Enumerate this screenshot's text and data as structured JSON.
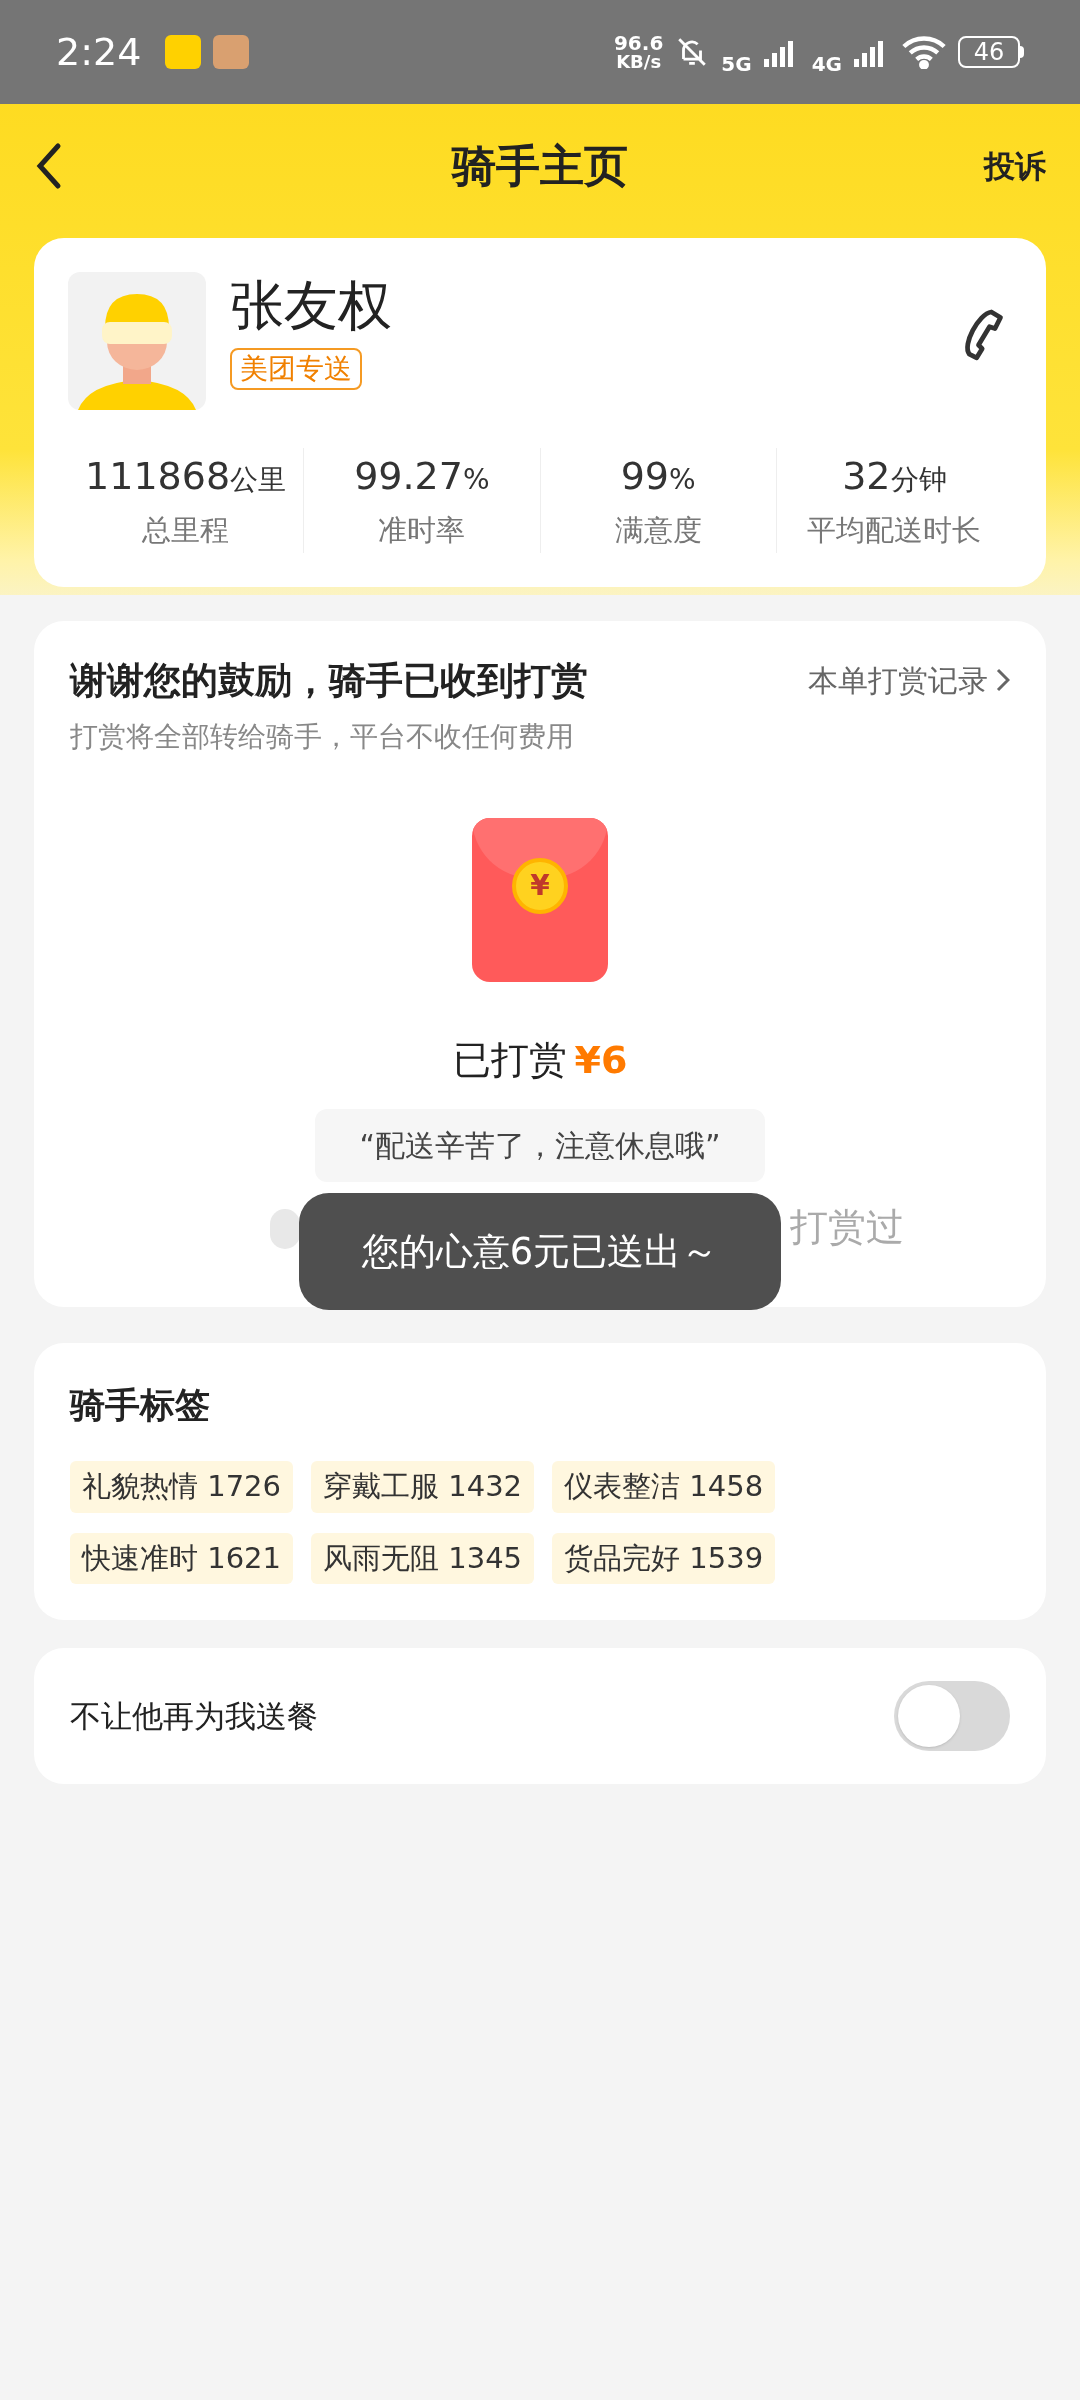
{
  "status_bar": {
    "time": "2:24",
    "speed_value": "96.6",
    "speed_unit": "KB/s",
    "net_1": "5G",
    "net_2": "4G",
    "battery": "46"
  },
  "header": {
    "title": "骑手主页",
    "action": "投诉"
  },
  "rider": {
    "name": "张友权",
    "badge": "美团专送",
    "stats": [
      {
        "value": "111868",
        "unit": "公里",
        "label": "总里程"
      },
      {
        "value": "99.27",
        "unit": "%",
        "label": "准时率"
      },
      {
        "value": "99",
        "unit": "%",
        "label": "满意度"
      },
      {
        "value": "32",
        "unit": "分钟",
        "label": "平均配送时长"
      }
    ]
  },
  "reward": {
    "title": "谢谢您的鼓励，骑手已收到打赏",
    "subtitle": "打赏将全部转给骑手，平台不收任何费用",
    "record_link": "本单打赏记录",
    "envelope_symbol": "¥",
    "amount_label": "已打赏",
    "amount": "¥6",
    "message": "“配送辛苦了，注意休息哦”",
    "tippers_text": "打赏过"
  },
  "toast": "您的心意6元已送出～",
  "tags": {
    "title": "骑手标签",
    "items": [
      "礼貌热情 1726",
      "穿戴工服 1432",
      "仪表整洁 1458",
      "快速准时 1621",
      "风雨无阻 1345",
      "货品完好 1539"
    ]
  },
  "block": {
    "label": "不让他再为我送餐",
    "on": false
  }
}
